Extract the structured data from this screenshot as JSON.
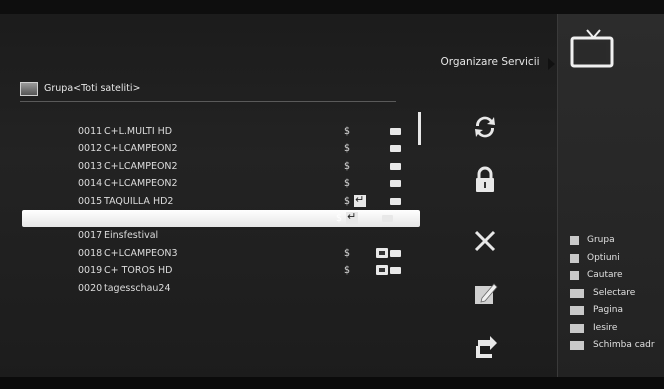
{
  "header": {
    "title": "Organizare Servicii"
  },
  "group": {
    "label": "Grupa<Toti sateliti>"
  },
  "channels": [
    {
      "num": "0011",
      "name": "C+L.MULTI HD",
      "dollar": "$",
      "ret": false,
      "lock": false,
      "hd": true
    },
    {
      "num": "0012",
      "name": "C+LCAMPEON2",
      "dollar": "$",
      "ret": false,
      "lock": false,
      "hd": true
    },
    {
      "num": "0013",
      "name": "C+LCAMPEON2",
      "dollar": "$",
      "ret": false,
      "lock": false,
      "hd": true
    },
    {
      "num": "0014",
      "name": "C+LCAMPEON2",
      "dollar": "$",
      "ret": false,
      "lock": false,
      "hd": true
    },
    {
      "num": "0015",
      "name": "TAQUILLA HD2",
      "dollar": "$",
      "ret": true,
      "lock": false,
      "hd": true
    },
    {
      "num": "",
      "name": "",
      "dollar": "$",
      "ret": true,
      "lock": false,
      "hd": true,
      "selected": true
    },
    {
      "num": "0017",
      "name": "Einsfestival",
      "dollar": "",
      "ret": false,
      "lock": false,
      "hd": false
    },
    {
      "num": "0018",
      "name": "C+LCAMPEON3",
      "dollar": "$",
      "ret": false,
      "lock": true,
      "hd": true
    },
    {
      "num": "0019",
      "name": "C+ TOROS HD",
      "dollar": "$",
      "ret": false,
      "lock": true,
      "hd": true
    },
    {
      "num": "0020",
      "name": "tagesschau24",
      "dollar": "",
      "ret": false,
      "lock": false,
      "hd": false
    }
  ],
  "side_icons": [
    "swap-icon",
    "lock-icon",
    "delete-icon",
    "rename-icon",
    "move-icon"
  ],
  "legend": [
    {
      "key": "red-key",
      "label": "Grupa",
      "color": "#c9c9c9"
    },
    {
      "key": "green-key",
      "label": "Optiuni",
      "color": "#c9c9c9"
    },
    {
      "key": "search-key",
      "label": "Cautare",
      "color": "#c9c9c9"
    },
    {
      "key": "one-key",
      "label": "Selectare",
      "color": "#c9c9c9"
    },
    {
      "key": "page-key",
      "label": "Pagina",
      "color": "#c9c9c9"
    },
    {
      "key": "exit-key",
      "label": "Iesire",
      "color": "#c9c9c9"
    },
    {
      "key": "lr-key",
      "label": "Schimba cadr",
      "color": "#c9c9c9"
    }
  ]
}
